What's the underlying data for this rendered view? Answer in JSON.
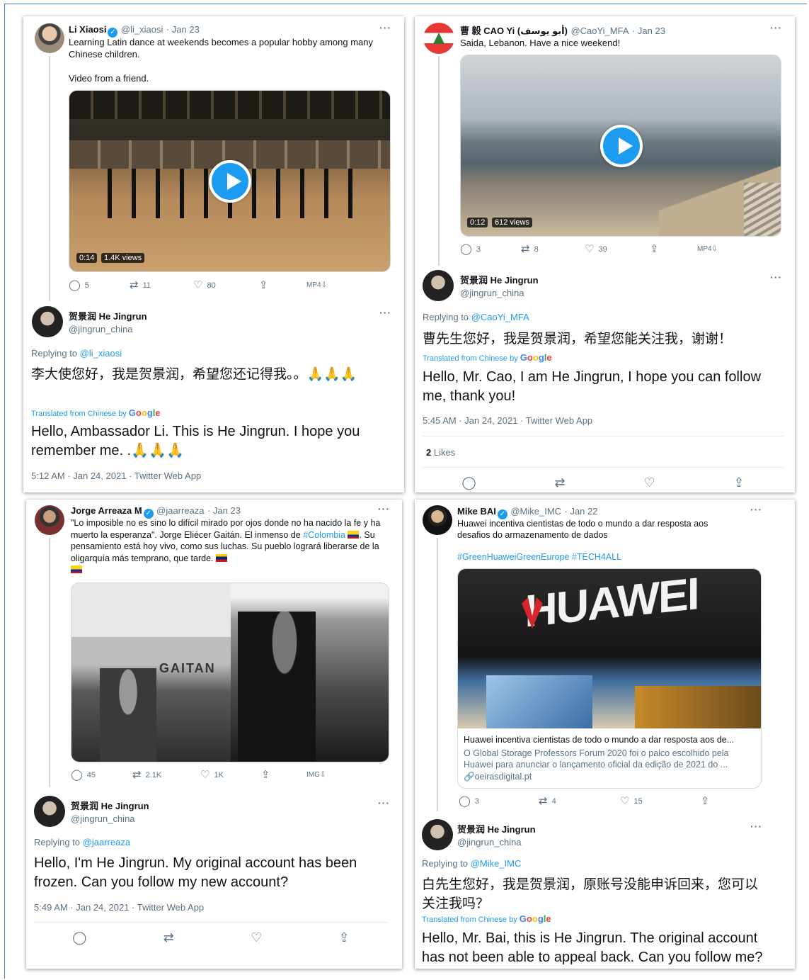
{
  "panels": {
    "p1": {
      "orig": {
        "name": "Li Xiaosi",
        "handle": "@li_xiaosi",
        "date": "· Jan 23",
        "text1": "Learning Latin dance at weekends becomes a popular hobby among many Chinese children.",
        "text2": "Video from a friend.",
        "video_time": "0:14",
        "video_views": "1.4K views",
        "replies": "5",
        "retweets": "11",
        "likes": "80",
        "media": "MP4⇩"
      },
      "reply": {
        "name": "贺景润 He Jingrun",
        "handle": "@jingrun_china",
        "replying_label": "Replying to",
        "replying_to": "@li_xiaosi",
        "original_text": "李大使您好，我是贺景润，希望您还记得我。。🙏🙏🙏",
        "translated_label": "Translated from Chinese by",
        "translation": "Hello, Ambassador Li. This is He Jingrun. I hope you remember me. .🙏🙏🙏",
        "meta": "5:12 AM · Jan 24, 2021 · Twitter Web App"
      }
    },
    "p2": {
      "orig": {
        "name": "曹 毅 CAO Yi (أبو يوسف)",
        "handle": "@CaoYi_MFA",
        "date": "· Jan 23",
        "text1": "Saida, Lebanon. Have a nice weekend!",
        "video_time": "0:12",
        "video_views": "612 views",
        "replies": "3",
        "retweets": "8",
        "likes": "39",
        "media": "MP4⇩"
      },
      "reply": {
        "name": "贺景润 He Jingrun",
        "handle": "@jingrun_china",
        "replying_label": "Replying to",
        "replying_to": "@CaoYi_MFA",
        "original_text": "曹先生您好，我是贺景润，希望您能关注我，谢谢！",
        "translated_label": "Translated from Chinese by",
        "translation": "Hello, Mr. Cao, I am He Jingrun, I hope you can follow me, thank you!",
        "meta": "5:45 AM · Jan 24, 2021 · Twitter Web App",
        "likes_count": "2",
        "likes_label": "Likes"
      }
    },
    "p3": {
      "orig": {
        "name": "Jorge Arreaza M",
        "handle": "@jaarreaza",
        "date": "· Jan 23",
        "text1": "\"Lo imposible no es sino lo difícil mirado por ojos donde no ha nacido la fe y ha muerto la esperanza\". Jorge Eliécer Gaitán. El inmenso de",
        "hashtag": "#Colombia",
        "text2": ". Su pensamiento está hoy vivo, como sus luchas. Su pueblo logrará liberarse de la oligarquía más temprano, que tarde.",
        "banner_text": "GAITAN",
        "replies": "45",
        "retweets": "2.1K",
        "likes": "1K",
        "media": "IMG⇩"
      },
      "reply": {
        "name": "贺景润 He Jingrun",
        "handle": "@jingrun_china",
        "replying_label": "Replying to",
        "replying_to": "@jaarreaza",
        "translation": "Hello, I'm He Jingrun. My original account has been frozen. Can you follow my new account?",
        "meta": "5:49 AM · Jan 24, 2021 · Twitter Web App"
      }
    },
    "p4": {
      "orig": {
        "name": "Mike BAI",
        "handle": "@Mike_IMC",
        "date": "· Jan 22",
        "text1": "Huawei incentiva cientistas de todo o mundo a dar resposta aos desafios do armazenamento de dados",
        "hashtags": "#GreenHuaweiGreenEurope #TECH4ALL",
        "image_text": "HUAWEI",
        "card_title": "Huawei incentiva cientistas de todo o mundo a dar resposta aos de...",
        "card_desc": "O Global Storage Professors Forum 2020 foi o palco escolhido pela Huawei para anunciar o lançamento oficial da edição de 2021 do ...",
        "card_domain": "oeirasdigital.pt",
        "replies": "3",
        "retweets": "4",
        "likes": "15"
      },
      "reply": {
        "name": "贺景润 He Jingrun",
        "handle": "@jingrun_china",
        "replying_label": "Replying to",
        "replying_to": "@Mike_IMC",
        "original_text": "白先生您好，我是贺景润，原账号没能申诉回来，您可以关注我吗？",
        "translated_label": "Translated from Chinese by",
        "translation": "Hello, Mr. Bai, this is He Jingrun. The original account has not been able to appeal back. Can you follow me?"
      }
    }
  },
  "icons": {
    "more": "···",
    "reply": "reply-icon",
    "retweet": "retweet-icon",
    "like": "heart-icon",
    "share": "share-icon",
    "verified": "verified-badge-icon",
    "play": "play-icon",
    "link": "link-icon"
  },
  "colors": {
    "accent": "#1d9bf0",
    "muted": "#5b7083",
    "text": "#0f1419"
  }
}
